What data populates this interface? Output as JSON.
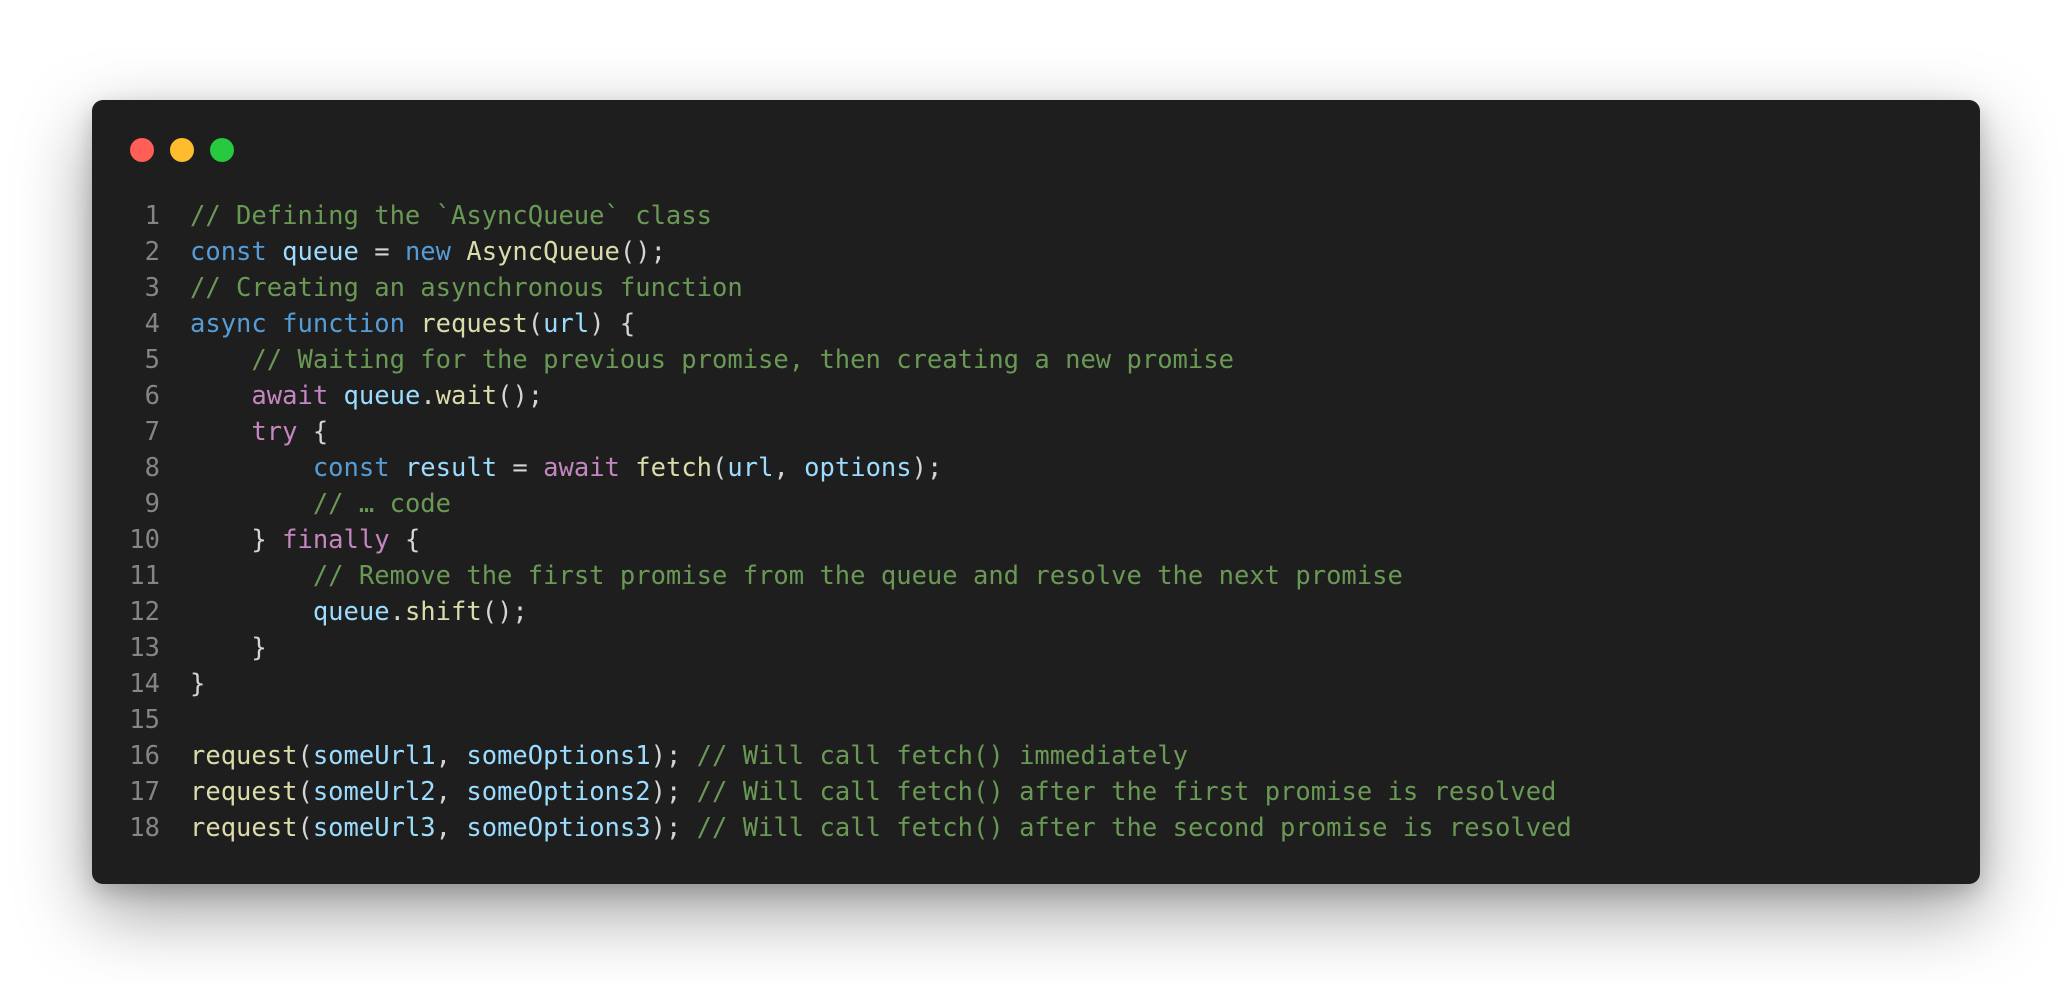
{
  "window": {
    "traffic_lights": {
      "close_color": "#ff5f56",
      "minimize_color": "#ffbd2e",
      "maximize_color": "#27c93f"
    }
  },
  "code_lines": [
    {
      "number": "1",
      "tokens": [
        {
          "text": "// Defining the `AsyncQueue` class",
          "type": "comment"
        }
      ]
    },
    {
      "number": "2",
      "tokens": [
        {
          "text": "const",
          "type": "keyword"
        },
        {
          "text": " ",
          "type": "punc"
        },
        {
          "text": "queue",
          "type": "var"
        },
        {
          "text": " = ",
          "type": "punc"
        },
        {
          "text": "new",
          "type": "keyword"
        },
        {
          "text": " ",
          "type": "punc"
        },
        {
          "text": "AsyncQueue",
          "type": "func"
        },
        {
          "text": "();",
          "type": "punc"
        }
      ]
    },
    {
      "number": "3",
      "tokens": [
        {
          "text": "// Creating an asynchronous function",
          "type": "comment"
        }
      ]
    },
    {
      "number": "4",
      "tokens": [
        {
          "text": "async",
          "type": "keyword"
        },
        {
          "text": " ",
          "type": "punc"
        },
        {
          "text": "function",
          "type": "keyword"
        },
        {
          "text": " ",
          "type": "punc"
        },
        {
          "text": "request",
          "type": "func"
        },
        {
          "text": "(",
          "type": "punc"
        },
        {
          "text": "url",
          "type": "var"
        },
        {
          "text": ") {",
          "type": "punc"
        }
      ]
    },
    {
      "number": "5",
      "tokens": [
        {
          "text": "    ",
          "type": "punc"
        },
        {
          "text": "// Waiting for the previous promise, then creating a new promise",
          "type": "comment"
        }
      ]
    },
    {
      "number": "6",
      "tokens": [
        {
          "text": "    ",
          "type": "punc"
        },
        {
          "text": "await",
          "type": "control"
        },
        {
          "text": " ",
          "type": "punc"
        },
        {
          "text": "queue",
          "type": "var"
        },
        {
          "text": ".",
          "type": "punc"
        },
        {
          "text": "wait",
          "type": "func"
        },
        {
          "text": "();",
          "type": "punc"
        }
      ]
    },
    {
      "number": "7",
      "tokens": [
        {
          "text": "    ",
          "type": "punc"
        },
        {
          "text": "try",
          "type": "control"
        },
        {
          "text": " {",
          "type": "punc"
        }
      ]
    },
    {
      "number": "8",
      "tokens": [
        {
          "text": "        ",
          "type": "punc"
        },
        {
          "text": "const",
          "type": "keyword"
        },
        {
          "text": " ",
          "type": "punc"
        },
        {
          "text": "result",
          "type": "var"
        },
        {
          "text": " = ",
          "type": "punc"
        },
        {
          "text": "await",
          "type": "control"
        },
        {
          "text": " ",
          "type": "punc"
        },
        {
          "text": "fetch",
          "type": "func"
        },
        {
          "text": "(",
          "type": "punc"
        },
        {
          "text": "url",
          "type": "var"
        },
        {
          "text": ", ",
          "type": "punc"
        },
        {
          "text": "options",
          "type": "var"
        },
        {
          "text": ");",
          "type": "punc"
        }
      ]
    },
    {
      "number": "9",
      "tokens": [
        {
          "text": "        ",
          "type": "punc"
        },
        {
          "text": "// … code",
          "type": "comment"
        }
      ]
    },
    {
      "number": "10",
      "tokens": [
        {
          "text": "    } ",
          "type": "punc"
        },
        {
          "text": "finally",
          "type": "control"
        },
        {
          "text": " {",
          "type": "punc"
        }
      ]
    },
    {
      "number": "11",
      "tokens": [
        {
          "text": "        ",
          "type": "punc"
        },
        {
          "text": "// Remove the first promise from the queue and resolve the next promise",
          "type": "comment"
        }
      ]
    },
    {
      "number": "12",
      "tokens": [
        {
          "text": "        ",
          "type": "punc"
        },
        {
          "text": "queue",
          "type": "var"
        },
        {
          "text": ".",
          "type": "punc"
        },
        {
          "text": "shift",
          "type": "func"
        },
        {
          "text": "();",
          "type": "punc"
        }
      ]
    },
    {
      "number": "13",
      "tokens": [
        {
          "text": "    }",
          "type": "punc"
        }
      ]
    },
    {
      "number": "14",
      "tokens": [
        {
          "text": "}",
          "type": "punc"
        }
      ]
    },
    {
      "number": "15",
      "tokens": []
    },
    {
      "number": "16",
      "tokens": [
        {
          "text": "request",
          "type": "func"
        },
        {
          "text": "(",
          "type": "punc"
        },
        {
          "text": "someUrl1",
          "type": "var"
        },
        {
          "text": ", ",
          "type": "punc"
        },
        {
          "text": "someOptions1",
          "type": "var"
        },
        {
          "text": "); ",
          "type": "punc"
        },
        {
          "text": "// Will call fetch() immediately",
          "type": "comment"
        }
      ]
    },
    {
      "number": "17",
      "tokens": [
        {
          "text": "request",
          "type": "func"
        },
        {
          "text": "(",
          "type": "punc"
        },
        {
          "text": "someUrl2",
          "type": "var"
        },
        {
          "text": ", ",
          "type": "punc"
        },
        {
          "text": "someOptions2",
          "type": "var"
        },
        {
          "text": "); ",
          "type": "punc"
        },
        {
          "text": "// Will call fetch() after the first promise is resolved",
          "type": "comment"
        }
      ]
    },
    {
      "number": "18",
      "tokens": [
        {
          "text": "request",
          "type": "func"
        },
        {
          "text": "(",
          "type": "punc"
        },
        {
          "text": "someUrl3",
          "type": "var"
        },
        {
          "text": ", ",
          "type": "punc"
        },
        {
          "text": "someOptions3",
          "type": "var"
        },
        {
          "text": "); ",
          "type": "punc"
        },
        {
          "text": "// Will call fetch() after the second promise is resolved",
          "type": "comment"
        }
      ]
    }
  ]
}
